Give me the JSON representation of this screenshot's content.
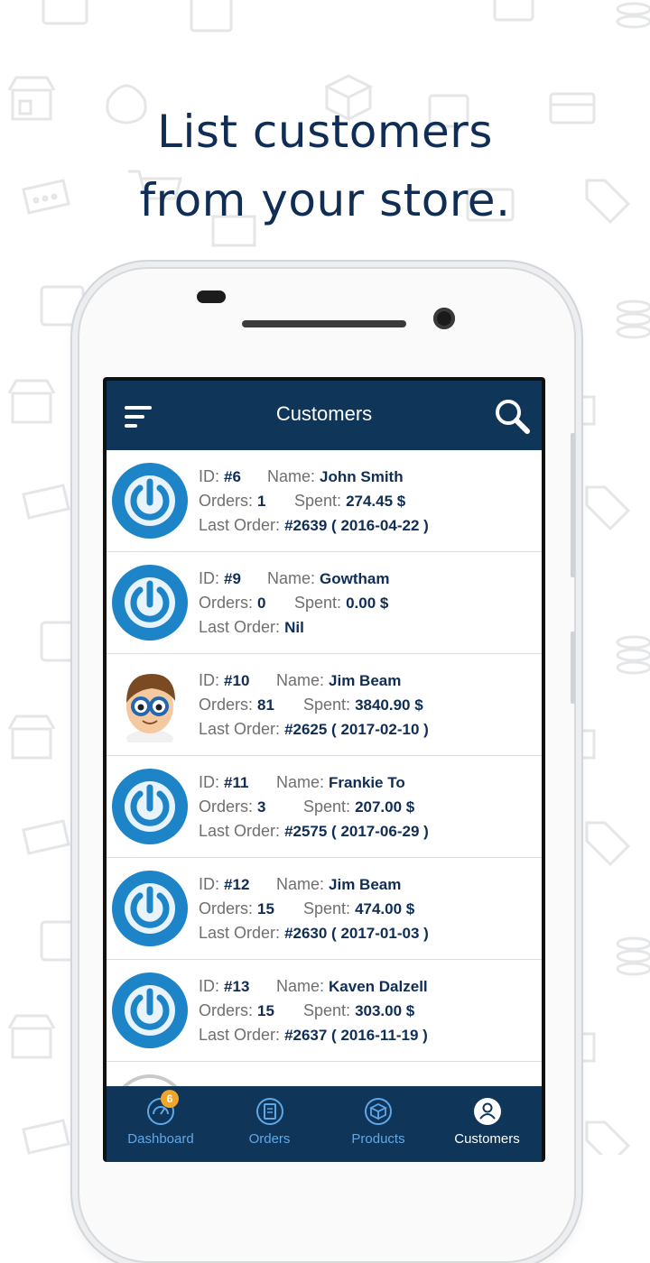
{
  "headline": {
    "line1": "List customers",
    "line2": "from your store."
  },
  "appbar": {
    "title": "Customers",
    "menu_icon": "menu-icon",
    "search_icon": "search-icon"
  },
  "labels": {
    "id": "ID:",
    "name": "Name:",
    "orders": "Orders:",
    "spent": "Spent:",
    "last_order": "Last Order:"
  },
  "customers": [
    {
      "id": "#6",
      "name": "John Smith",
      "orders": "1",
      "spent": "274.45 $",
      "last_order": "#2639 ( 2016-04-22 )",
      "avatar": "power-logo-avatar"
    },
    {
      "id": "#9",
      "name": "Gowtham",
      "orders": "0",
      "spent": "0.00 $",
      "last_order": "Nil",
      "avatar": "power-logo-avatar"
    },
    {
      "id": "#10",
      "name": "Jim Beam",
      "orders": "81",
      "spent": "3840.90 $",
      "last_order": "#2625 ( 2017-02-10 )",
      "avatar": "cartoon-boy-avatar"
    },
    {
      "id": "#11",
      "name": "Frankie To",
      "orders": "3",
      "spent": "207.00 $",
      "last_order": "#2575 ( 2017-06-29 )",
      "avatar": "power-logo-avatar"
    },
    {
      "id": "#12",
      "name": "Jim Beam",
      "orders": "15",
      "spent": "474.00 $",
      "last_order": "#2630 ( 2017-01-03 )",
      "avatar": "power-logo-avatar"
    },
    {
      "id": "#13",
      "name": "Kaven Dalzell",
      "orders": "15",
      "spent": "303.00 $",
      "last_order": "#2637 ( 2016-11-19 )",
      "avatar": "power-logo-avatar"
    }
  ],
  "bottom_nav": [
    {
      "label": "Dashboard",
      "icon": "dashboard-icon",
      "badge": "6",
      "active": false
    },
    {
      "label": "Orders",
      "icon": "orders-icon",
      "active": false
    },
    {
      "label": "Products",
      "icon": "products-icon",
      "active": false
    },
    {
      "label": "Customers",
      "icon": "customer-user-icon",
      "active": true
    }
  ],
  "colors": {
    "primary": "#0f3559",
    "headline": "#0f2d55",
    "nav_inactive": "#5fa8e8",
    "badge": "#f0a52a",
    "avatar_blue": "#1d84c7"
  }
}
